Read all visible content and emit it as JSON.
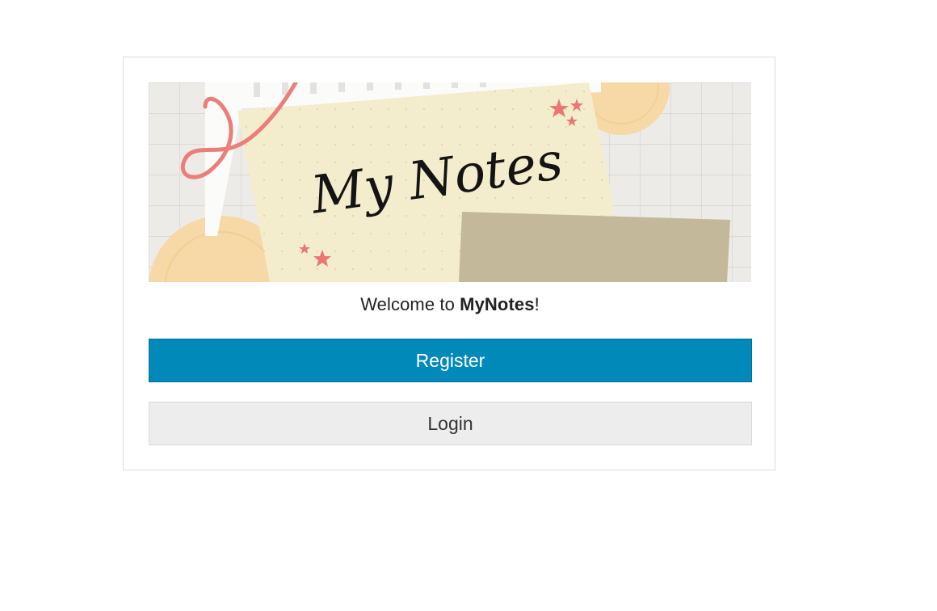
{
  "banner": {
    "logo_text": "My Notes"
  },
  "welcome": {
    "prefix": "Welcome to ",
    "app_name": "MyNotes",
    "suffix": "!"
  },
  "buttons": {
    "register_label": "Register",
    "login_label": "Login"
  },
  "colors": {
    "primary": "#0089b9",
    "secondary": "#ededed"
  }
}
